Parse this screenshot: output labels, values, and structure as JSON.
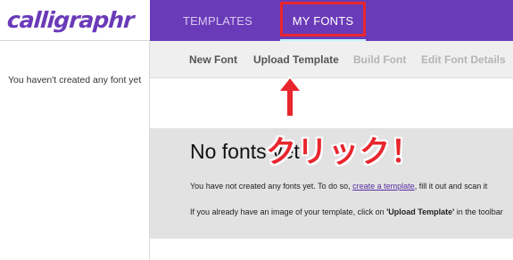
{
  "colors": {
    "brand": "#6a3bb8",
    "annotation": "#e8262d"
  },
  "app": {
    "logo_text": "calligraphr"
  },
  "nav": {
    "tabs": [
      {
        "label": "TEMPLATES",
        "active": false
      },
      {
        "label": "MY FONTS",
        "active": true
      }
    ]
  },
  "sidebar": {
    "empty_message": "You haven't created any font yet"
  },
  "toolbar": {
    "items": [
      {
        "label": "New Font",
        "enabled": true
      },
      {
        "label": "Upload Template",
        "enabled": true
      },
      {
        "label": "Build Font",
        "enabled": false
      },
      {
        "label": "Edit Font Details",
        "enabled": false
      }
    ]
  },
  "main": {
    "title": "No fonts yet",
    "line1_before": "You have not created any fonts yet. To do so, ",
    "line1_link": "create a template",
    "line1_after": ", fill it out and scan it",
    "line2_before": "If you already have an image of your template, click on ",
    "line2_bold": "'Upload Template'",
    "line2_after": " in the toolbar"
  },
  "annotation": {
    "callout_text": "クリック！",
    "icon": "up-arrow-icon"
  }
}
